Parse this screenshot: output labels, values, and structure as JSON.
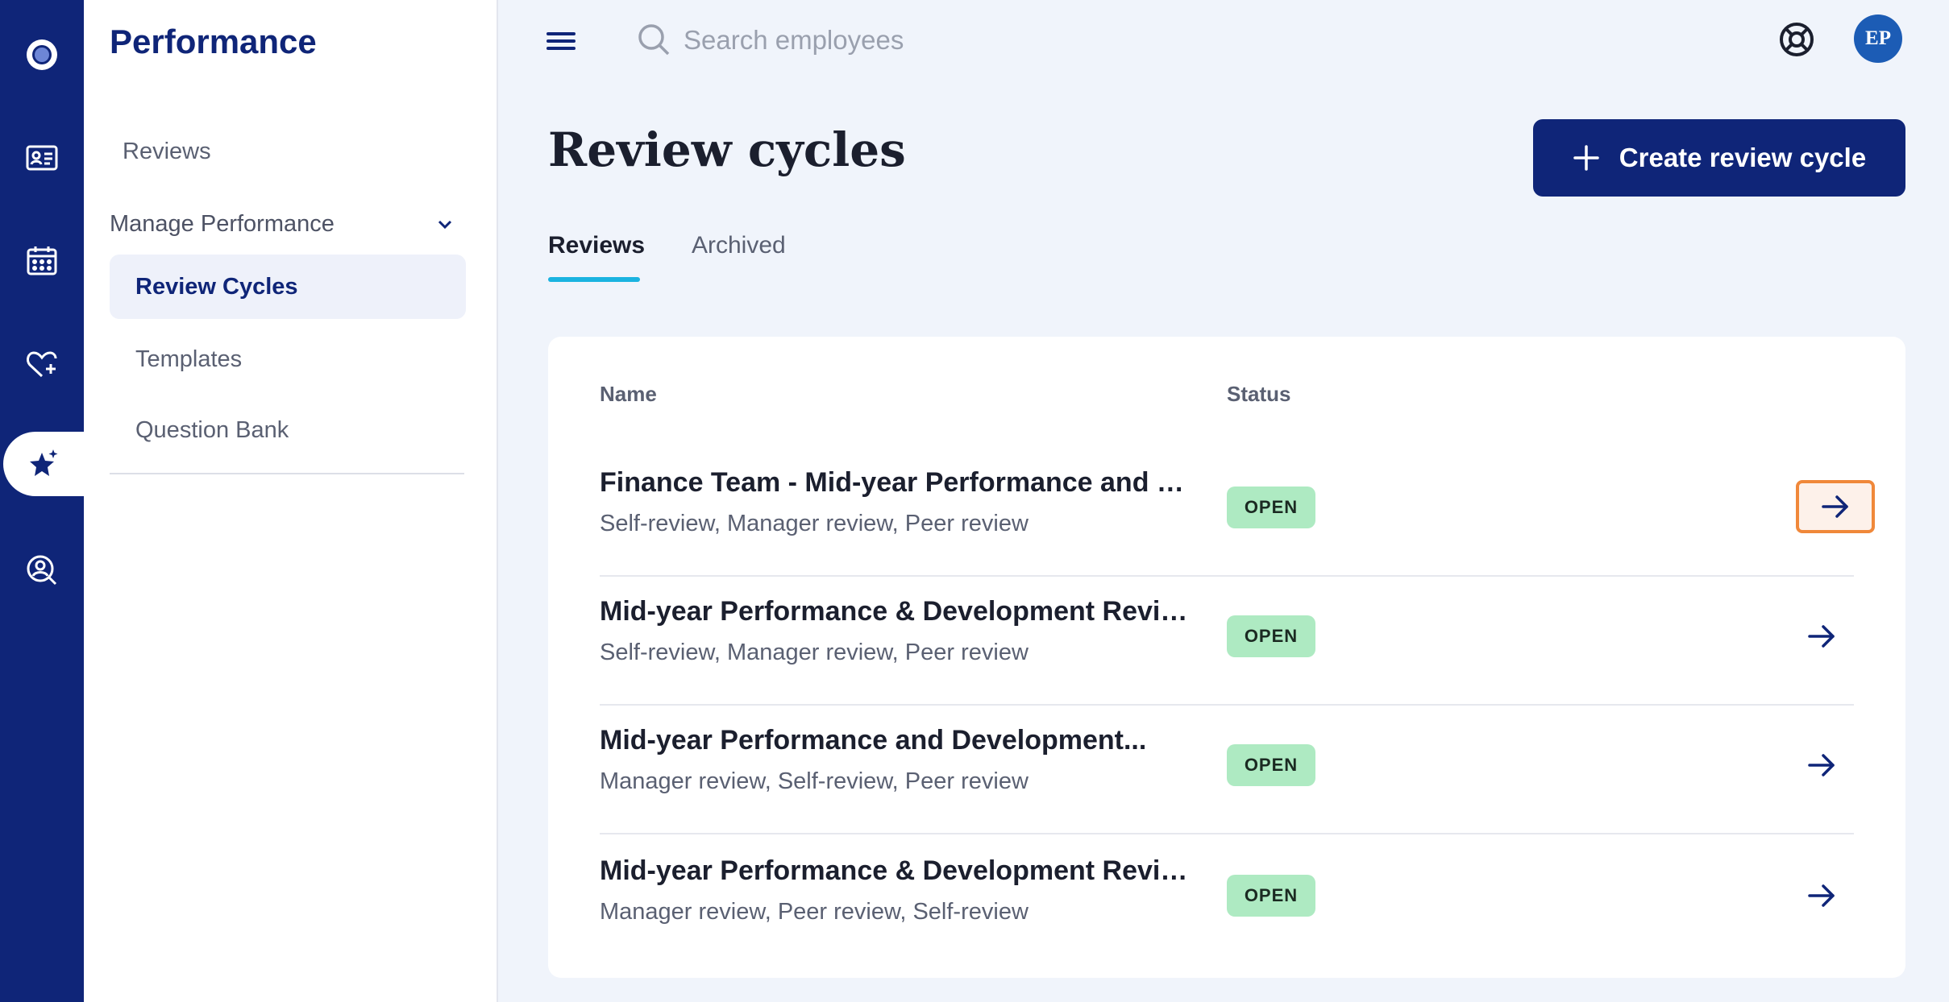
{
  "sidebar": {
    "title": "Performance",
    "items": [
      {
        "label": "Reviews"
      },
      {
        "label": "Manage Performance"
      },
      {
        "label": "Review Cycles"
      },
      {
        "label": "Templates"
      },
      {
        "label": "Question Bank"
      }
    ]
  },
  "rail": {
    "icons": [
      "logo-icon",
      "id-card-icon",
      "calendar-icon",
      "heart-plus-icon",
      "star-sparkle-icon",
      "user-search-icon"
    ],
    "active": "star-sparkle-icon"
  },
  "topbar": {
    "search_placeholder": "Search employees",
    "avatar_initials": "EP"
  },
  "header": {
    "title": "Review cycles",
    "create_label": "Create review cycle"
  },
  "tabs": [
    {
      "label": "Reviews",
      "active": true
    },
    {
      "label": "Archived",
      "active": false
    }
  ],
  "table": {
    "columns": [
      "Name",
      "Status"
    ],
    "rows": [
      {
        "name": "Finance Team - Mid-year Performance and De-...",
        "types": "Self-review, Manager review, Peer review",
        "status": "OPEN"
      },
      {
        "name": "Mid-year Performance & Development Review...",
        "types": "Self-review, Manager review, Peer review",
        "status": "OPEN"
      },
      {
        "name": "Mid-year Performance and Development...",
        "types": "Manager review, Self-review, Peer review",
        "status": "OPEN"
      },
      {
        "name": "Mid-year Performance & Development Review",
        "types": "Manager review, Peer review, Self-review",
        "status": "OPEN"
      }
    ]
  },
  "colors": {
    "brand": "#0f2578",
    "tab_accent": "#1ab3e0",
    "status_open": "#aeeac2",
    "focus_outline": "#f0883a"
  }
}
